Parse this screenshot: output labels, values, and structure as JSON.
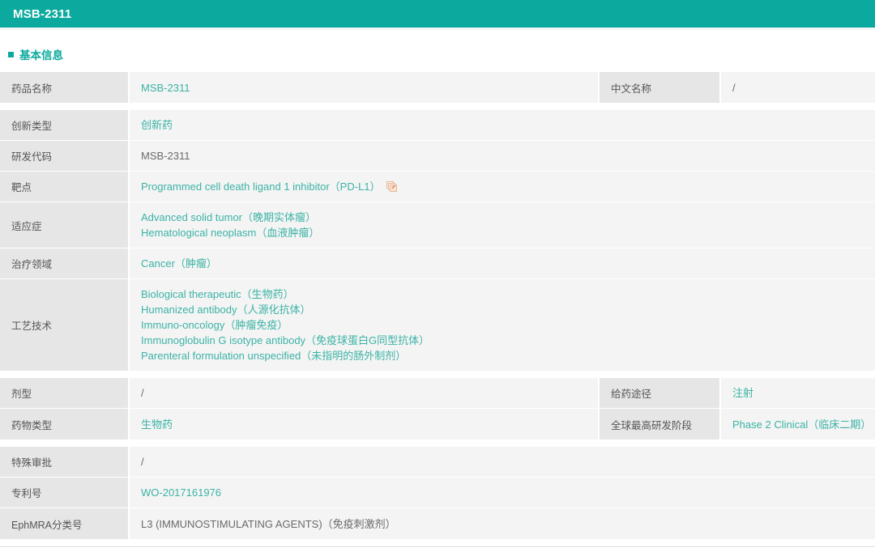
{
  "header": {
    "title": "MSB-2311"
  },
  "section": {
    "title": "基本信息",
    "bullet_icon": "square-bullet-icon"
  },
  "colors": {
    "brand_teal": "#0caa9e",
    "link_teal": "#3bb3a5",
    "label_bg": "#e6e6e6",
    "value_bg": "#f4f4f4",
    "icon_orange": "#e8b99a"
  },
  "groups": [
    {
      "rows": [
        {
          "label": "药品名称",
          "value_lines": [
            "MSB-2311"
          ],
          "style": "link",
          "right": {
            "label": "中文名称",
            "value_lines": [
              "/"
            ],
            "style": "plain"
          }
        }
      ]
    },
    {
      "rows": [
        {
          "label": "创新类型",
          "value_lines": [
            "创新药"
          ],
          "style": "link"
        },
        {
          "label": "研发代码",
          "value_lines": [
            "MSB-2311"
          ],
          "style": "plain"
        },
        {
          "label": "靶点",
          "value_lines": [
            "Programmed cell death ligand 1 inhibitor（PD-L1）"
          ],
          "style": "link",
          "icon": "external-link-icon"
        },
        {
          "label": "适应症",
          "value_lines": [
            "Advanced solid tumor（晚期实体瘤）",
            "Hematological neoplasm（血液肿瘤）"
          ],
          "style": "link"
        },
        {
          "label": "治疗领域",
          "value_lines": [
            "Cancer（肿瘤）"
          ],
          "style": "link"
        },
        {
          "label": "工艺技术",
          "value_lines": [
            "Biological therapeutic（生物药）",
            "Humanized antibody（人源化抗体）",
            "Immuno-oncology（肿瘤免疫）",
            "Immunoglobulin G isotype antibody（免疫球蛋白G同型抗体）",
            "Parenteral formulation unspecified（未指明的肠外制剂）"
          ],
          "style": "link"
        }
      ]
    },
    {
      "rows": [
        {
          "label": "剂型",
          "value_lines": [
            "/"
          ],
          "style": "plain",
          "right": {
            "label": "给药途径",
            "value_lines": [
              "注射"
            ],
            "style": "link"
          }
        },
        {
          "label": "药物类型",
          "value_lines": [
            "生物药"
          ],
          "style": "link",
          "right": {
            "label": "全球最高研发阶段",
            "value_lines": [
              "Phase 2 Clinical（临床二期）"
            ],
            "style": "link"
          }
        }
      ]
    },
    {
      "rows": [
        {
          "label": "特殊审批",
          "value_lines": [
            "/"
          ],
          "style": "plain"
        },
        {
          "label": "专利号",
          "value_lines": [
            "WO-2017161976"
          ],
          "style": "link"
        },
        {
          "label": "EphMRA分类号",
          "value_lines": [
            "L3 (IMMUNOSTIMULATING AGENTS)（免疫刺激剂）"
          ],
          "style": "plain"
        }
      ]
    }
  ]
}
